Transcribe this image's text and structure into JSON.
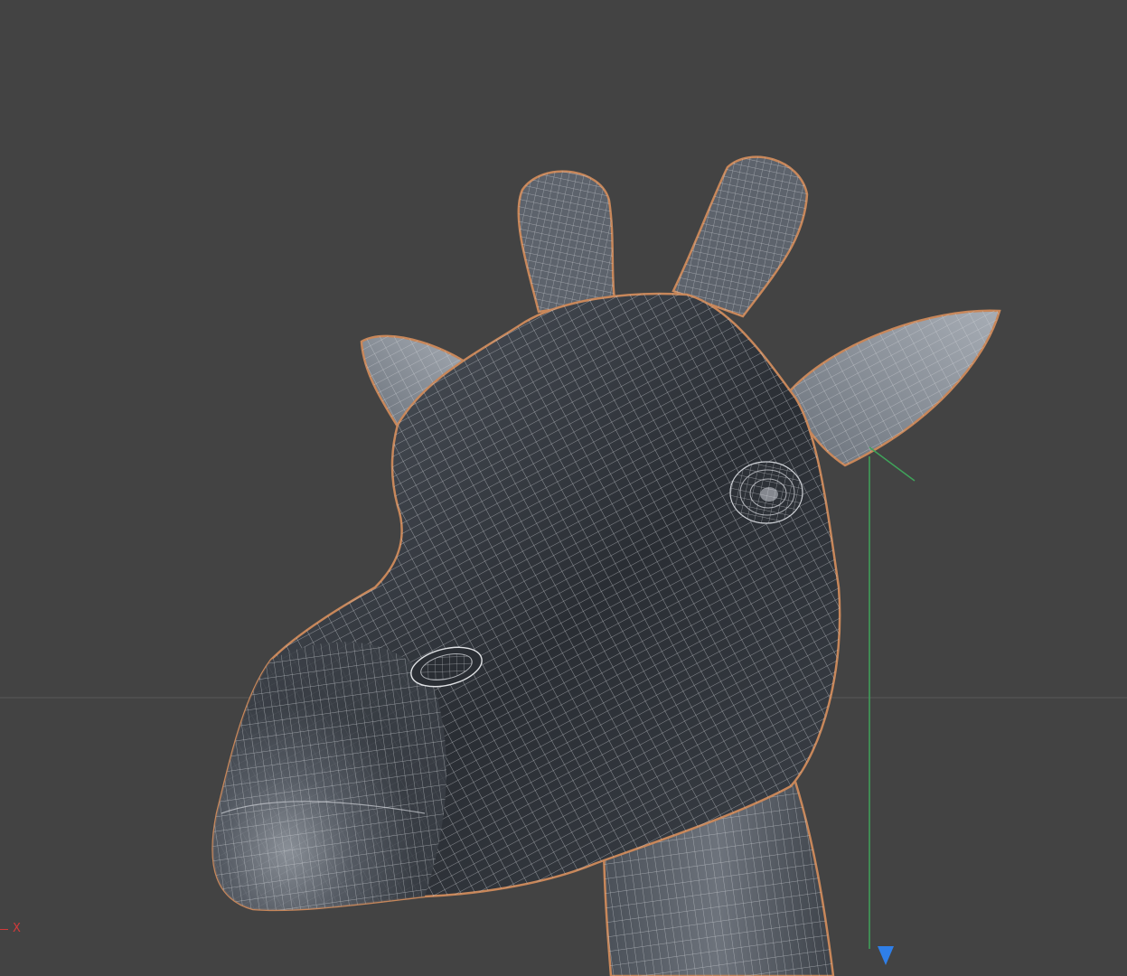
{
  "viewport": {
    "background_color": "#434343",
    "horizon_line_color": "#5a5a5a",
    "model": {
      "name": "giraffe-head",
      "display_mode": "wireframe-shaded",
      "mesh_fill": "#3f444c",
      "mesh_fill_highlight": "#8a9099",
      "wire_color": "#c9ccd1",
      "selection_outline_color": "#c8875a"
    },
    "gizmo": {
      "y_axis_color": "#3fa35a",
      "z_axis_color": "#3fa35a",
      "arrow_color": "#2f7fe8",
      "arrow_icon": "arrow-down-icon"
    },
    "world_axis_indicator": {
      "label": "X",
      "color": "#d23a3a"
    }
  }
}
